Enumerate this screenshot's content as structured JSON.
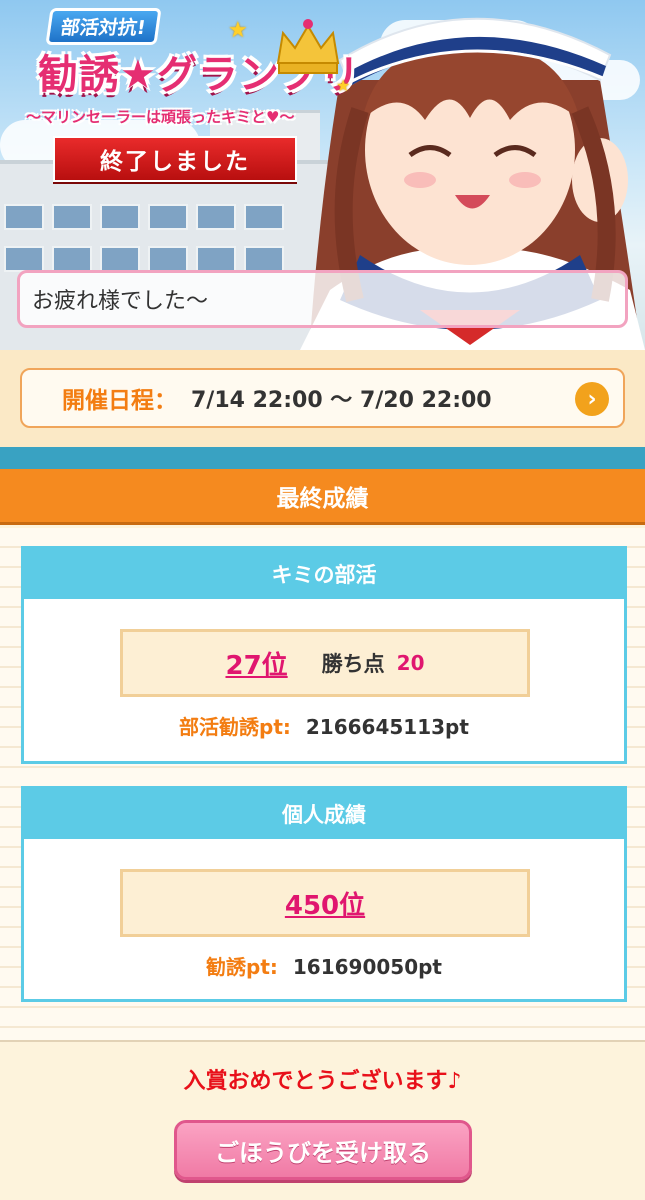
{
  "banner": {
    "event_tag": "部活対抗!",
    "event_title": "勧誘★グランプリ",
    "event_subtitle": "〜マリンセーラーは頑張ったキミと♥〜",
    "status": "終了しました",
    "message": "お疲れ様でした〜"
  },
  "schedule": {
    "label": "開催日程：",
    "value": "7/14 22:00 〜 7/20 22:00"
  },
  "final_results": {
    "title": "最終成績"
  },
  "club": {
    "title": "キミの部活",
    "rank": "27位",
    "win_label": "勝ち点",
    "win_value": "20",
    "pt_label": "部活勧誘pt:",
    "pt_value": "2166645113pt"
  },
  "personal": {
    "title": "個人成績",
    "rank": "450位",
    "pt_label": "勧誘pt:",
    "pt_value": "161690050pt"
  },
  "footer": {
    "congrats": "入賞おめでとうございます♪",
    "reward_button": "ごほうびを受け取る"
  },
  "colors": {
    "accent_orange": "#f58a1f",
    "card_blue": "#5ccbe6",
    "rank_pink": "#e0166f",
    "congrats_red": "#e8101a"
  }
}
